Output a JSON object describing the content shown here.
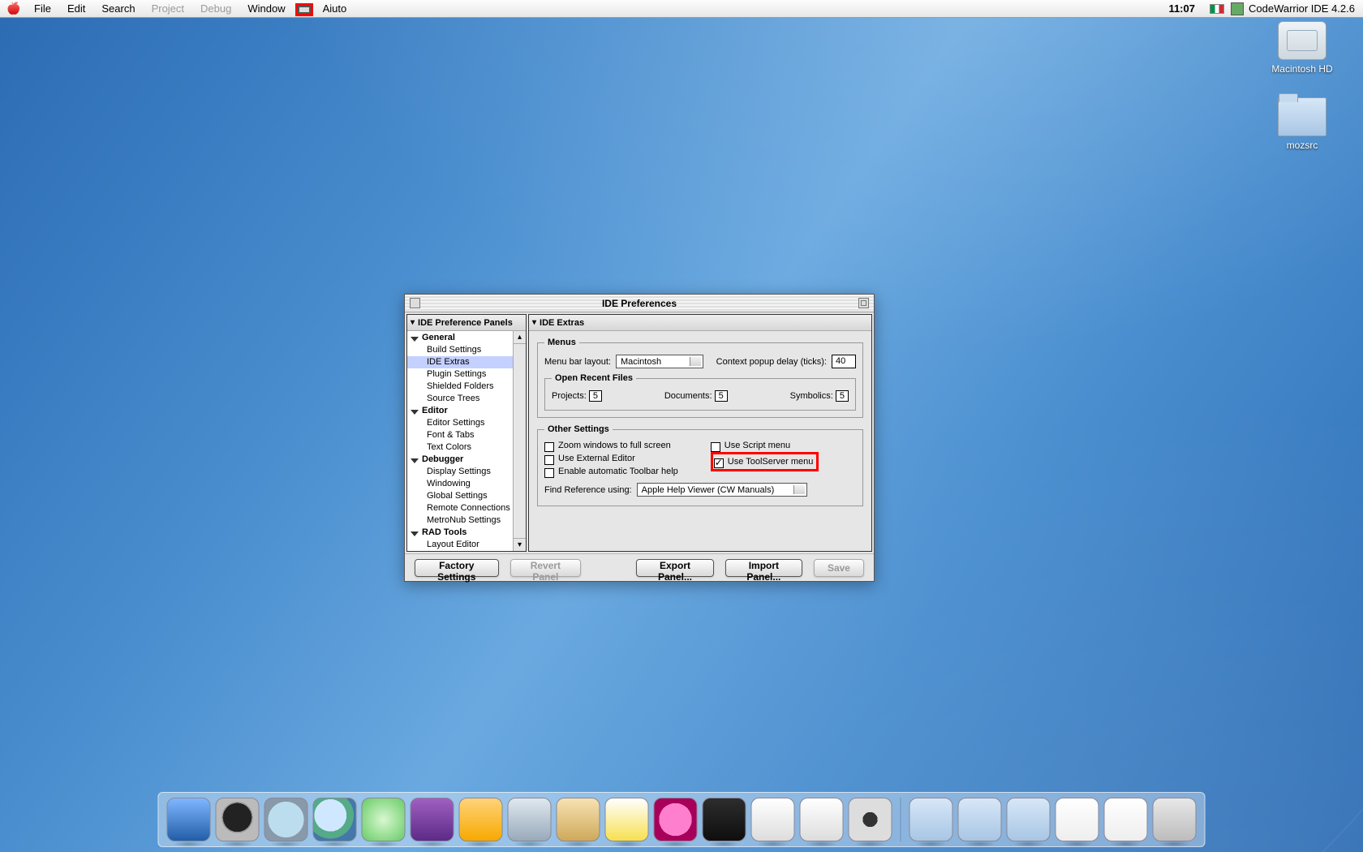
{
  "menubar": {
    "items": [
      "File",
      "Edit",
      "Search",
      "Project",
      "Debug",
      "Window",
      "Aiuto"
    ],
    "disabled_idx": [
      3,
      4
    ],
    "clock": "11:07",
    "app_name": "CodeWarrior IDE 4.2.6"
  },
  "desktop_icons": {
    "hd": "Macintosh HD",
    "folder": "mozsrc"
  },
  "window": {
    "title": "IDE Preferences",
    "tree_header": "IDE Preference Panels",
    "tree": [
      {
        "group": "General",
        "items": [
          "Build Settings",
          "IDE Extras",
          "Plugin Settings",
          "Shielded Folders",
          "Source Trees"
        ]
      },
      {
        "group": "Editor",
        "items": [
          "Editor Settings",
          "Font & Tabs",
          "Text Colors"
        ]
      },
      {
        "group": "Debugger",
        "items": [
          "Display Settings",
          "Windowing",
          "Global Settings",
          "Remote Connections",
          "MetroNub Settings"
        ]
      },
      {
        "group": "RAD Tools",
        "items": [
          "Layout Editor"
        ]
      }
    ],
    "selected_leaf": "IDE Extras",
    "detail_header": "IDE Extras",
    "menus_group": {
      "legend": "Menus",
      "layout_label": "Menu bar layout:",
      "layout_value": "Macintosh",
      "delay_label": "Context popup delay (ticks):",
      "delay_value": "40",
      "recent_legend": "Open Recent Files",
      "recent": {
        "projects_label": "Projects:",
        "projects_value": "5",
        "documents_label": "Documents:",
        "documents_value": "5",
        "symbolics_label": "Symbolics:",
        "symbolics_value": "5"
      }
    },
    "other_group": {
      "legend": "Other Settings",
      "zoom": {
        "label": "Zoom windows to full screen",
        "checked": false
      },
      "ext": {
        "label": "Use External Editor",
        "checked": false
      },
      "tb": {
        "label": "Enable automatic Toolbar help",
        "checked": false
      },
      "script": {
        "label": "Use Script menu",
        "checked": false
      },
      "ts": {
        "label": "Use ToolServer menu",
        "checked": true
      },
      "ref_label": "Find Reference using:",
      "ref_value": "Apple Help Viewer (CW Manuals)"
    },
    "buttons": {
      "factory": "Factory Settings",
      "revert": "Revert Panel",
      "export": "Export Panel...",
      "import": "Import Panel...",
      "save": "Save"
    }
  }
}
